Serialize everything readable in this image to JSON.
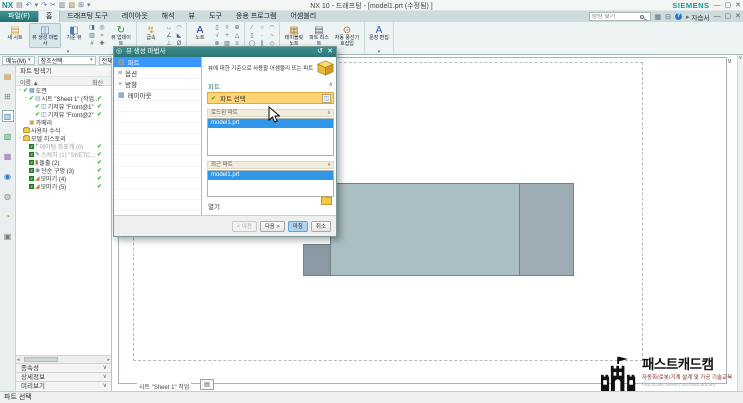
{
  "window": {
    "logo": "NX",
    "title": "NX 10 - 드래프팅 - [model1.prt (수정됨) ]",
    "brand": "SIEMENS"
  },
  "qat": {
    "icons": [
      "save-icon",
      "undo-icon",
      "undo-dropdown-icon",
      "redo-icon",
      "cut-icon",
      "copy-icon",
      "paste-icon",
      "window-icon",
      "window-dropdown-icon"
    ]
  },
  "tabs": {
    "file_tab": "파일(F)",
    "items": [
      {
        "label": "홈",
        "active": true
      },
      {
        "label": "드래프팅 도구"
      },
      {
        "label": "레이아웃"
      },
      {
        "label": "해석"
      },
      {
        "label": "뷰"
      },
      {
        "label": "도구"
      },
      {
        "label": "응용 프로그램"
      },
      {
        "label": "어셈블리"
      }
    ]
  },
  "topbar": {
    "search_placeholder": "명령 찾기",
    "tutorial_label": "자습서"
  },
  "ribbon": {
    "groups": [
      {
        "name": "view-group",
        "buttons": [
          {
            "type": "big",
            "label": "새 시트",
            "icon": "new-sheet"
          },
          {
            "type": "big",
            "label": "뷰 생성 마법사",
            "icon": "view-wizard",
            "active": true
          },
          {
            "type": "big",
            "label": "기준 뷰",
            "icon": "base-view"
          },
          {
            "type": "grid",
            "cols": 2,
            "icons": [
              "projected-view",
              "detail-view",
              "section-view",
              "break-view",
              "crop-view",
              "exploded-view"
            ]
          },
          {
            "type": "big",
            "label": "뷰 업데이트",
            "icon": "update-views"
          }
        ]
      },
      {
        "name": "dimension-group",
        "buttons": [
          {
            "type": "big",
            "label": "급속",
            "icon": "rapid-dimension"
          },
          {
            "type": "grid",
            "cols": 2,
            "icons": [
              "linear-dimension",
              "radial-dimension",
              "angular-dimension",
              "chamfer-dimension",
              "ordinate-dimension",
              "diameter-dimension"
            ]
          }
        ]
      },
      {
        "name": "annotation-group",
        "buttons": [
          {
            "type": "big",
            "label": "노트",
            "icon": "note"
          },
          {
            "type": "grid",
            "cols": 3,
            "icons": [
              "feature-control-frame",
              "datum-feature",
              "balloon",
              "surface-finish",
              "center-mark",
              "weld-symbol",
              "target-point",
              "crosshatch",
              "symbol"
            ]
          }
        ]
      },
      {
        "name": "sketch-group",
        "buttons": [
          {
            "type": "grid",
            "cols": 3,
            "icons": [
              "line",
              "circle",
              "arc",
              "rectangle",
              "point",
              "spline",
              "ellipse",
              "offset-curve",
              "polygon"
            ]
          }
        ]
      },
      {
        "name": "table-group",
        "buttons": [
          {
            "type": "big",
            "label": "테이블릿 노트",
            "icon": "tabular-note"
          },
          {
            "type": "big",
            "label": "파트 리스트",
            "icon": "parts-list"
          },
          {
            "type": "big",
            "label": "자동 풍선기호삽입",
            "icon": "auto-balloon"
          }
        ]
      },
      {
        "name": "edit-group",
        "buttons": [
          {
            "type": "big",
            "label": "문장 편집",
            "icon": "edit-text"
          }
        ]
      }
    ]
  },
  "selection_bar": {
    "menu_label": "메뉴(M)",
    "type_filter": "참조선택",
    "scope_filter": "전체 어셈블리"
  },
  "resource_bar": {
    "icons": [
      "assembly-navigator-icon",
      "constraint-navigator-icon",
      "part-navigator-icon",
      "reuse-library-icon",
      "view-palette-icon",
      "hd3d-tools-icon",
      "web-browser-icon",
      "history-icon",
      "process-studio-icon"
    ],
    "active": "part-navigator-icon"
  },
  "navigator": {
    "title": "파트 탐색기",
    "columns": {
      "name": "이름",
      "updated": "최신"
    },
    "rows": [
      {
        "label": "도면",
        "level": 0,
        "expanded": true,
        "precheck": true,
        "icon": "drawing",
        "updated": false
      },
      {
        "label": "시트 \"Sheet 1\" (작업...",
        "level": 1,
        "expanded": true,
        "precheck": true,
        "icon": "sheet",
        "updated": true
      },
      {
        "label": "기저뷰 \"Front@1\"",
        "level": 2,
        "precheck": true,
        "icon": "base-view",
        "updated": true
      },
      {
        "label": "기저뷰 \"Front@2\"",
        "level": 2,
        "precheck": true,
        "icon": "base-view",
        "updated": true
      },
      {
        "label": "카메라",
        "level": 1,
        "icon": "camera",
        "updated": false
      },
      {
        "label": "사용자 수식",
        "level": 0,
        "icon": "folder",
        "updated": false
      },
      {
        "label": "모델 히스토리",
        "level": 0,
        "expanded": true,
        "icon": "folder",
        "updated": false
      },
      {
        "label": "데이텀 좌표계 (0)",
        "level": 1,
        "checkbox": true,
        "icon": "datum-csys",
        "updated": true,
        "dim": true
      },
      {
        "label": "스케치 (1) \"SKETCH...\"",
        "level": 1,
        "checkbox": true,
        "icon": "sketch",
        "updated": true,
        "dim": true
      },
      {
        "label": "돌출 (2)",
        "level": 1,
        "checkbox": true,
        "icon": "extrude",
        "updated": true
      },
      {
        "label": "단순 구멍 (3)",
        "level": 1,
        "checkbox": true,
        "icon": "hole",
        "updated": true
      },
      {
        "label": "모따기 (4)",
        "level": 1,
        "checkbox": true,
        "icon": "chamfer",
        "updated": true
      },
      {
        "label": "모따기 (5)",
        "level": 1,
        "checkbox": true,
        "icon": "chamfer",
        "updated": true
      }
    ]
  },
  "panels": {
    "items": [
      "종속성",
      "상세정보",
      "미리보기"
    ]
  },
  "canvas": {
    "sheet_tab": "시트 \"Sheet 1\" 작업",
    "view_colors": {
      "body": "#aabfc3",
      "end": "#9dacb4",
      "boss": "#8a99a3",
      "edge": "#72838a"
    }
  },
  "dialog": {
    "title": "뷰 생성 마법사",
    "steps": [
      {
        "label": "파트",
        "active": true
      },
      {
        "label": "옵션"
      },
      {
        "label": "방향"
      },
      {
        "label": "레이아웃"
      }
    ],
    "description": "뷰에 대한 기준으로 사용할 어셈블리 또는 파트 선택",
    "section_part": "파트",
    "select_part_label": "파트 선택",
    "loaded_parts_label": "로드된 파트",
    "loaded_parts": [
      "model1.prt"
    ],
    "recent_parts_label": "최근 파트",
    "recent_parts": [
      "model1.prt"
    ],
    "open_label": "열기",
    "buttons": [
      {
        "label": "< 이전",
        "disabled": true
      },
      {
        "label": "다음 >"
      },
      {
        "label": "마침",
        "primary": true
      },
      {
        "label": "취소"
      }
    ]
  },
  "watermark": {
    "title": "패스트캐드캠",
    "subtitle": "자동화/로봇/기계 설계 및 가공 기술교육",
    "url": "http://cafe.naver.com/fastcadcam"
  },
  "statusbar": {
    "text": "파트 선택"
  },
  "colors": {
    "accent_teal": "#2e8585",
    "selection_blue": "#2f96ea",
    "highlight_orange": "#ffd473",
    "check_green": "#2e9e2e"
  }
}
